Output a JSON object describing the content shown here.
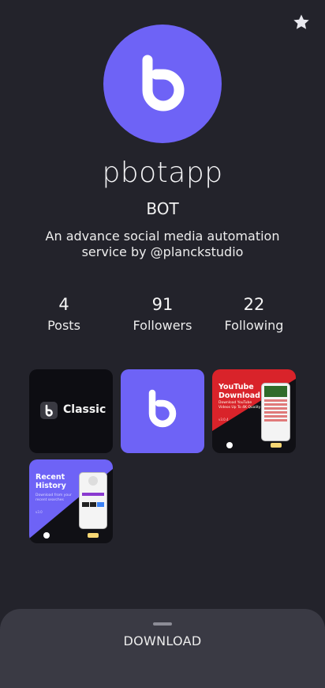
{
  "profile": {
    "username": "pbotapp",
    "category": "BOT",
    "bio": "An advance social media automation service by @planckstudio"
  },
  "stats": [
    {
      "value": "4",
      "label": "Posts"
    },
    {
      "value": "91",
      "label": "Followers"
    },
    {
      "value": "22",
      "label": "Following"
    }
  ],
  "posts": [
    {
      "label": "Classic"
    },
    {
      "label": ""
    },
    {
      "title_line1": "YouTube",
      "title_line2": "Download",
      "subtitle": "Download YouTube Videos Up To 4K Quality",
      "version": "v3.0.4"
    },
    {
      "title_line1": "Recent",
      "title_line2": "History",
      "subtitle": "Download from your recent searches",
      "version": "v3.0"
    }
  ],
  "bottom_sheet": {
    "button_label": "DOWNLOAD"
  },
  "colors": {
    "background": "#23232b",
    "accent": "#6e63f6",
    "youtube_red": "#d9232a",
    "sheet": "#3a3a44"
  }
}
